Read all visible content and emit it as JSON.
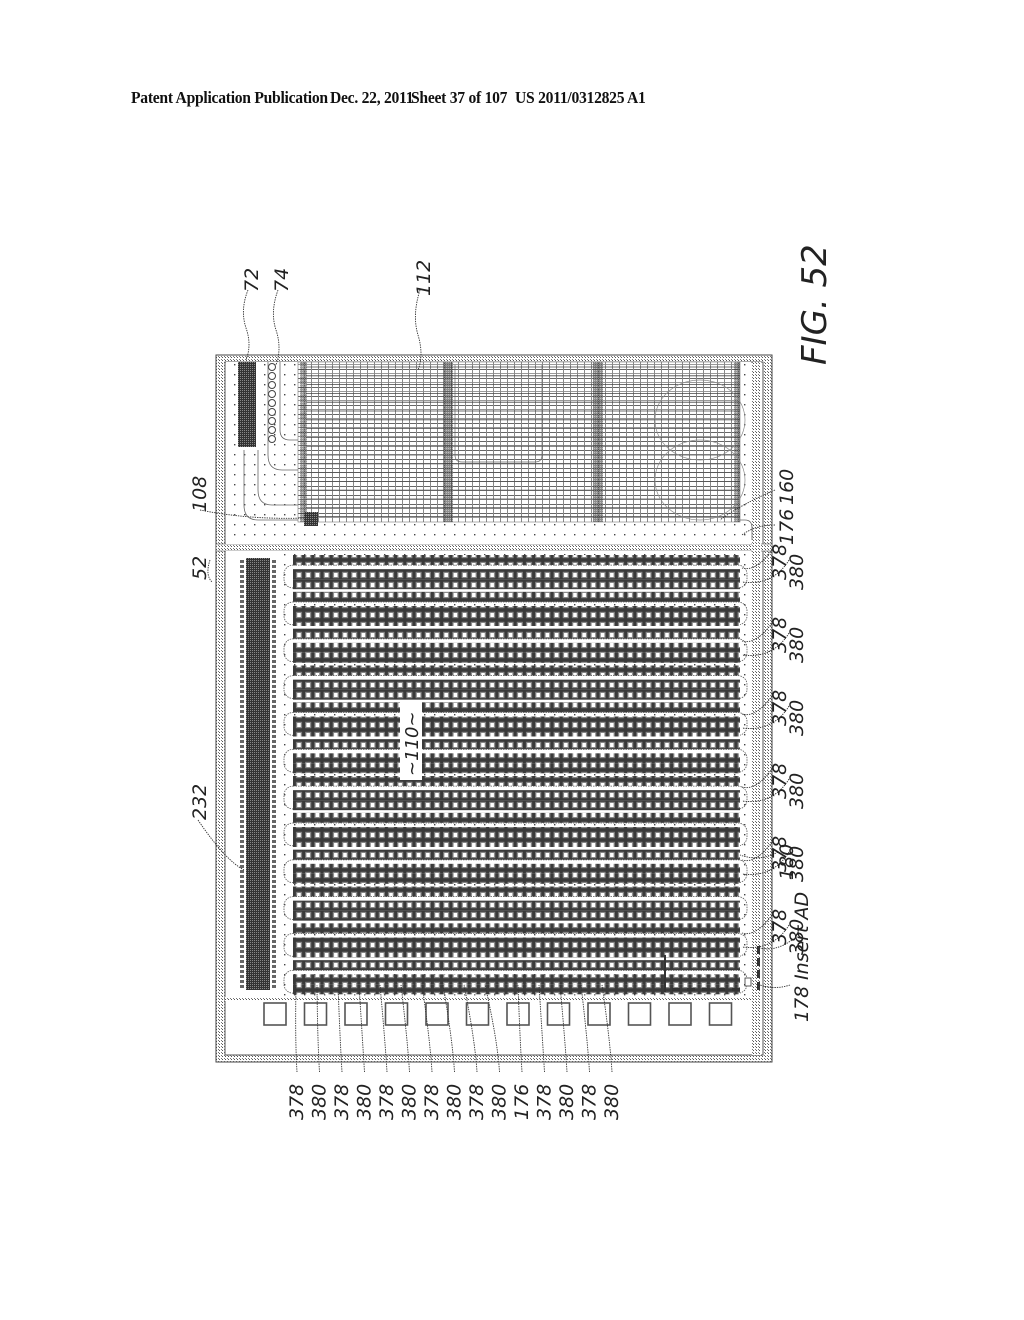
{
  "header": {
    "publication": "Patent Application Publication",
    "date": "Dec. 22, 2011",
    "sheet": "Sheet 37 of 107",
    "number": "US 2011/0312825 A1"
  },
  "figure": {
    "caption": "FIG. 52",
    "labels": {
      "device": "52",
      "contacts": "72",
      "vias": "74",
      "wiring_region": "112",
      "connector": "108",
      "drive_circuit": "232",
      "nozzle_region": "~110~",
      "region_160": "160",
      "region_176": "176",
      "region_180": "180",
      "region_178": "178",
      "insert": "Insert AD",
      "row_a": "378",
      "row_b": "380"
    },
    "right_labels": [
      "176",
      "378",
      "380",
      "378",
      "380",
      "378",
      "380",
      "378",
      "380",
      "378",
      "380",
      "378",
      "380",
      "180"
    ],
    "bottom_labels": [
      "378",
      "380",
      "378",
      "380",
      "378",
      "380",
      "378",
      "380",
      "378",
      "380",
      "176",
      "378",
      "380",
      "378",
      "380"
    ],
    "pad_count": 12,
    "nozzle_row_pairs": 12
  }
}
